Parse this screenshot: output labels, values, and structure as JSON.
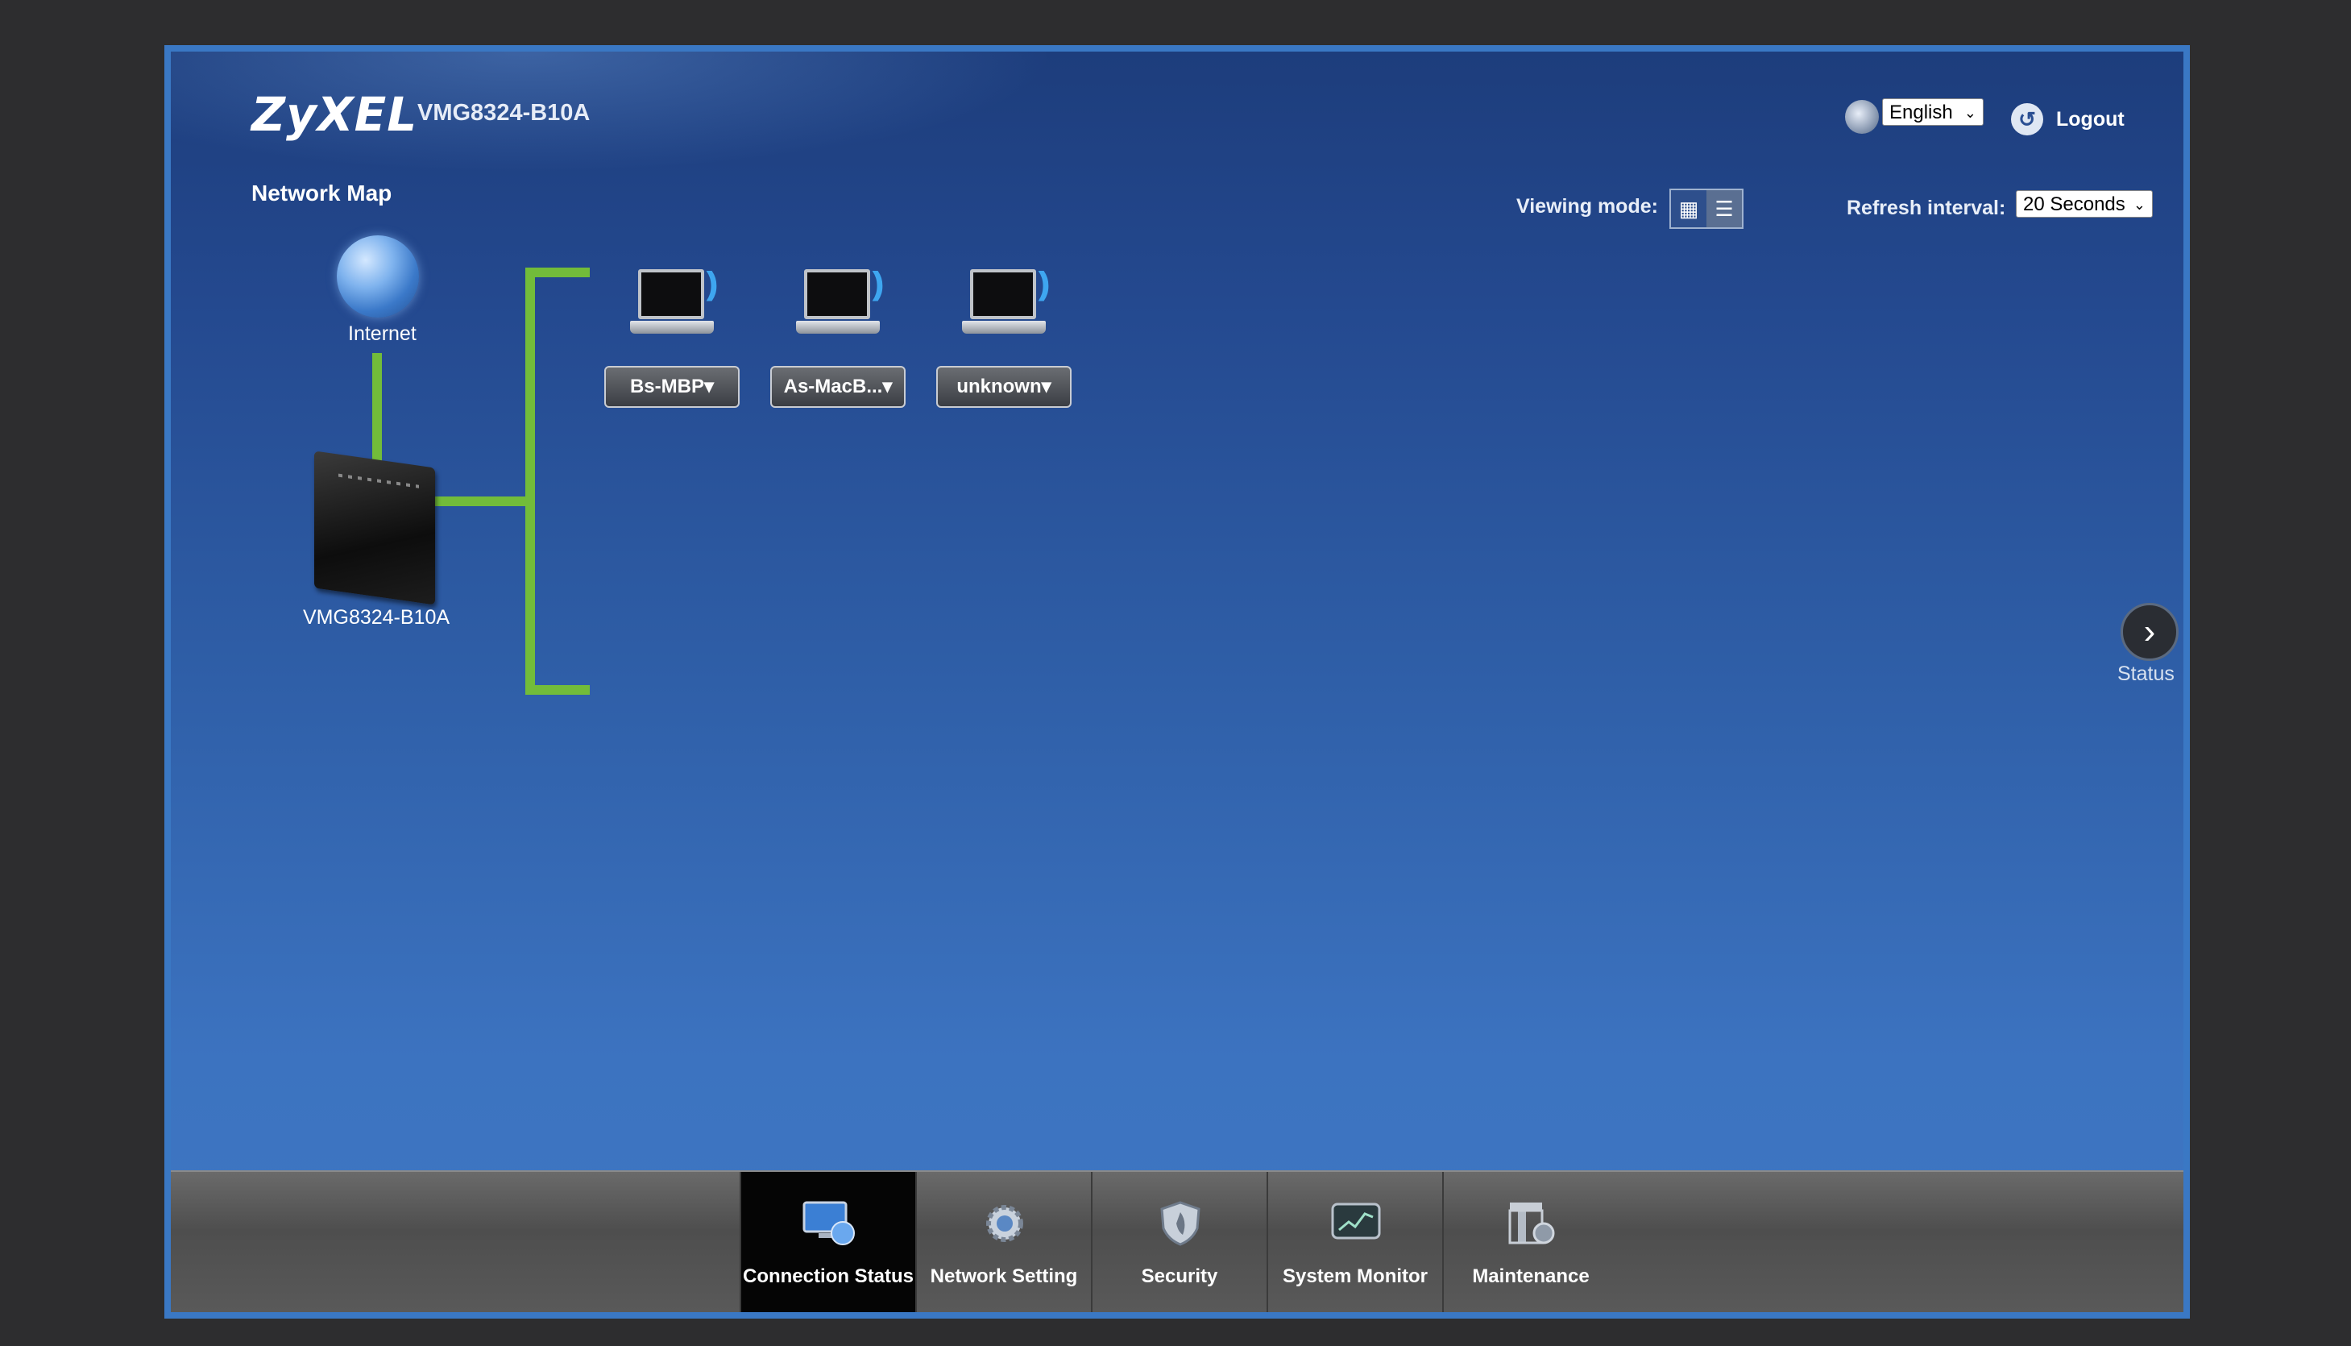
{
  "header": {
    "brand": "ZyXEL",
    "model": "VMG8324-B10A",
    "language_selected": "English",
    "logout_label": "Logout"
  },
  "page": {
    "title": "Network Map",
    "viewing_mode_label": "Viewing mode:",
    "refresh_label": "Refresh interval:",
    "refresh_selected": "20 Seconds"
  },
  "map": {
    "internet_label": "Internet",
    "router_label": "VMG8324-B10A",
    "devices": [
      {
        "label": "Bs-MBP▾"
      },
      {
        "label": "As-MacB...▾"
      },
      {
        "label": "unknown▾"
      }
    ]
  },
  "status_panel": {
    "label": "Status"
  },
  "bottom_nav": {
    "tabs": [
      {
        "label": "Connection Status",
        "icon": "monitor-globe-icon",
        "active": true
      },
      {
        "label": "Network Setting",
        "icon": "gear-icon",
        "active": false
      },
      {
        "label": "Security",
        "icon": "shield-icon",
        "active": false
      },
      {
        "label": "System Monitor",
        "icon": "chart-monitor-icon",
        "active": false
      },
      {
        "label": "Maintenance",
        "icon": "maintenance-icon",
        "active": false
      }
    ]
  },
  "colors": {
    "link_line": "#72bc3a",
    "frame_border": "#3a78c4",
    "wifi_wave": "#3ea6f0"
  }
}
